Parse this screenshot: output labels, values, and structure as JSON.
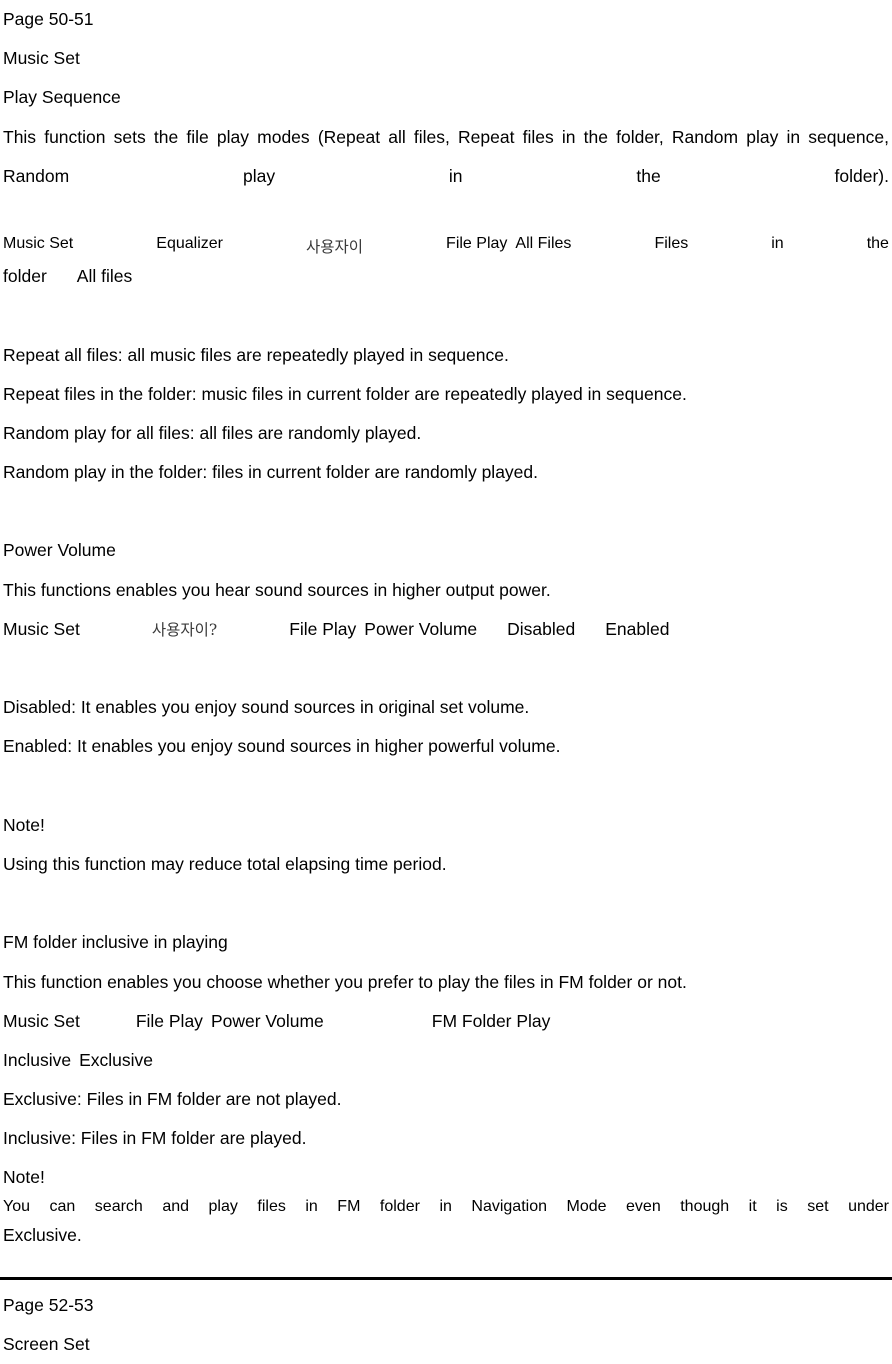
{
  "document": {
    "background_color": "#ffffff",
    "text_color": "#000000"
  },
  "section_1": {
    "page_marker": "Page 50-51",
    "heading": "Music Set",
    "subheading": "Play Sequence",
    "description": "This function sets the file play modes (Repeat all files, Repeat files in the folder, Random play in sequence, Random play in the folder).",
    "menu_path": {
      "item_1": "Music Set",
      "item_2": "Equalizer",
      "item_3": "사용자이",
      "item_4": "File Play",
      "item_5": "All Files",
      "item_6": "Files",
      "item_7": "in",
      "item_8": "the",
      "item_9": "folder",
      "item_10": "All files"
    },
    "modes": {
      "mode_1": "Repeat all files: all music files are repeatedly played in sequence.",
      "mode_2": "Repeat files in the folder: music files in current folder are repeatedly played in sequence.",
      "mode_3": "Random play for all files: all files are randomly played.",
      "mode_4": "Random play in the folder: files in current folder are randomly played."
    }
  },
  "section_2": {
    "heading": "Power Volume",
    "description": "This functions enables you hear sound sources in higher output power.",
    "menu_path": {
      "item_1": "Music Set",
      "item_2": "사용자이?",
      "item_3": "File Play",
      "item_4": "Power Volume",
      "item_5": "Disabled",
      "item_6": "Enabled"
    },
    "options": {
      "option_1": "Disabled: It enables you enjoy sound sources in original set volume.",
      "option_2": "Enabled: It enables you enjoy sound sources in higher powerful volume."
    },
    "note_label": "Note!",
    "note_text": "Using this function may reduce total elapsing time period."
  },
  "section_3": {
    "heading": "FM folder inclusive in playing",
    "description": "This function enables you choose whether you prefer to play the files in FM folder or not.",
    "menu_path": {
      "item_1": "Music Set",
      "item_2": "File Play",
      "item_3": "Power Volume",
      "item_4": "FM Folder Play"
    },
    "options_line": {
      "option_1": "Inclusive",
      "option_2": "Exclusive"
    },
    "option_desc_1": "Exclusive: Files in FM folder are not played.",
    "option_desc_2": "Inclusive: Files in FM folder are played.",
    "note_label": "Note!",
    "note_text": {
      "word_1": "You",
      "word_2": "can",
      "word_3": "search",
      "word_4": "and",
      "word_5": "play",
      "word_6": "files",
      "word_7": "in",
      "word_8": "FM",
      "word_9": "folder",
      "word_10": "in",
      "word_11": "Navigation",
      "word_12": "Mode",
      "word_13": "even",
      "word_14": "though",
      "word_15": "it",
      "word_16": "is",
      "word_17": "set",
      "word_18": "under",
      "continuation": "Exclusive."
    }
  },
  "section_4": {
    "page_marker": "Page 52-53",
    "heading": "Screen Set"
  }
}
